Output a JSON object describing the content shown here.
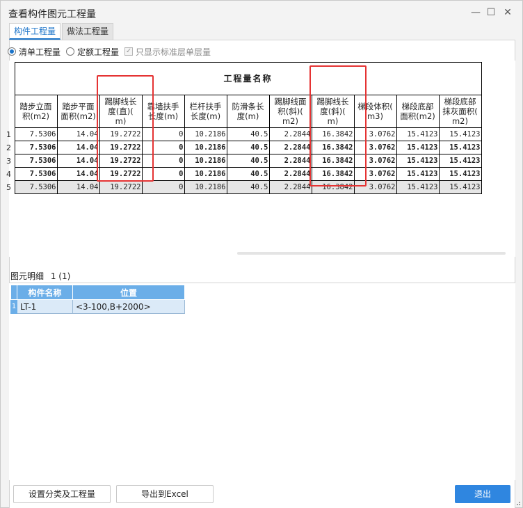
{
  "window": {
    "title": "查看构件图元工程量",
    "minimize_glyph": "—",
    "maximize_glyph": "☐",
    "close_glyph": "✕"
  },
  "tabs": [
    {
      "label": "构件工程量",
      "active": true
    },
    {
      "label": "做法工程量",
      "active": false
    }
  ],
  "options": {
    "radio_qingdan": "清单工程量",
    "radio_dinge": "定额工程量",
    "checkbox_label": "只显示标准层单层量",
    "checkbox_glyph": "✓",
    "selected": "清单工程量"
  },
  "quantity_table": {
    "group_header": "工程量名称",
    "columns": [
      "踏步立面积(m2)",
      "踏步平面面积(m2)",
      "踢脚线长度(直)(m)",
      "靠墙扶手长度(m)",
      "栏杆扶手长度(m)",
      "防滑条长度(m)",
      "踢脚线面积(斜)(m2)",
      "踢脚线长度(斜)(m)",
      "梯段体积(m3)",
      "梯段底部面积(m2)",
      "梯段底部抹灰面积(m2)"
    ],
    "columns_display": [
      "踏步立面\n积(m2)",
      "踏步平面\n面积(m2)",
      "踢脚线长\n度(直)(\nm)",
      "靠墙扶手\n长度(m)",
      "栏杆扶手\n长度(m)",
      "防滑条长\n度(m)",
      "踢脚线面\n积(斜)(\nm2)",
      "踢脚线长\n度(斜)(\nm)",
      "梯段体积(\nm3)",
      "梯段底部\n面积(m2)",
      "梯段底部\n抹灰面积(\nm2)"
    ],
    "rows": [
      {
        "num": "1",
        "style": "normal",
        "cells": [
          "7.5306",
          "14.04",
          "19.2722",
          "0",
          "10.2186",
          "40.5",
          "2.2844",
          "16.3842",
          "3.0762",
          "15.4123",
          "15.4123"
        ]
      },
      {
        "num": "2",
        "style": "bold",
        "cells": [
          "7.5306",
          "14.04",
          "19.2722",
          "0",
          "10.2186",
          "40.5",
          "2.2844",
          "16.3842",
          "3.0762",
          "15.4123",
          "15.4123"
        ]
      },
      {
        "num": "3",
        "style": "bold",
        "cells": [
          "7.5306",
          "14.04",
          "19.2722",
          "0",
          "10.2186",
          "40.5",
          "2.2844",
          "16.3842",
          "3.0762",
          "15.4123",
          "15.4123"
        ]
      },
      {
        "num": "4",
        "style": "bold",
        "cells": [
          "7.5306",
          "14.04",
          "19.2722",
          "0",
          "10.2186",
          "40.5",
          "2.2844",
          "16.3842",
          "3.0762",
          "15.4123",
          "15.4123"
        ]
      },
      {
        "num": "5",
        "style": "shade",
        "cells": [
          "7.5306",
          "14.04",
          "19.2722",
          "0",
          "10.2186",
          "40.5",
          "2.2844",
          "16.3842",
          "3.0762",
          "15.4123",
          "15.4123"
        ]
      }
    ]
  },
  "highlight_color": "#e53333",
  "detail": {
    "label": "图元明细",
    "count": "1 (1)",
    "columns": [
      "构件名称",
      "位置"
    ],
    "rows": [
      {
        "num": "1",
        "name": "LT-1",
        "position": "<3-100,B+2000>"
      }
    ]
  },
  "buttons": {
    "set_category": "设置分类及工程量",
    "export_excel": "导出到Excel",
    "exit": "退出"
  },
  "colors": {
    "accent": "#1a73c9",
    "primary_button": "#2f86e0",
    "detail_header": "#6baee8"
  }
}
